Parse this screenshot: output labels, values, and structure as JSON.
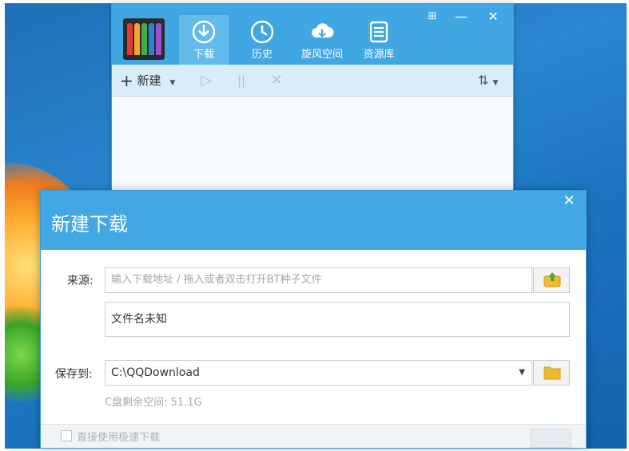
{
  "main_window": {
    "tabs": [
      {
        "label": "下载",
        "icon": "download-icon",
        "active": true
      },
      {
        "label": "历史",
        "icon": "history-clock-icon",
        "active": false
      },
      {
        "label": "旋风空间",
        "icon": "cloud-space-icon",
        "active": false
      },
      {
        "label": "资源库",
        "icon": "resource-library-icon",
        "active": false
      }
    ],
    "window_controls": {
      "pin": "⊞",
      "minimize": "—",
      "close": "✕"
    },
    "toolbar": {
      "new_label": "新建",
      "play_icon": "▷",
      "pause_icon": "||",
      "delete_icon": "✕",
      "sort_icon": "⇅"
    }
  },
  "dialog": {
    "title": "新建下载",
    "close_icon": "✕",
    "source_label": "来源:",
    "source_placeholder": "输入下载地址 / 拖入或者双击打开BT种子文件",
    "filename_value": "文件名未知",
    "save_label": "保存到:",
    "save_path": "C:\\QQDownload",
    "free_space": "C盘剩余空间: 51.1G",
    "fast_download_label": "直接使用极速下载",
    "fast_download_checked": false
  },
  "colors": {
    "accent": "#41a7e3",
    "tab_active": "#63bbec",
    "toolbar_bg": "#d8ecf9"
  }
}
